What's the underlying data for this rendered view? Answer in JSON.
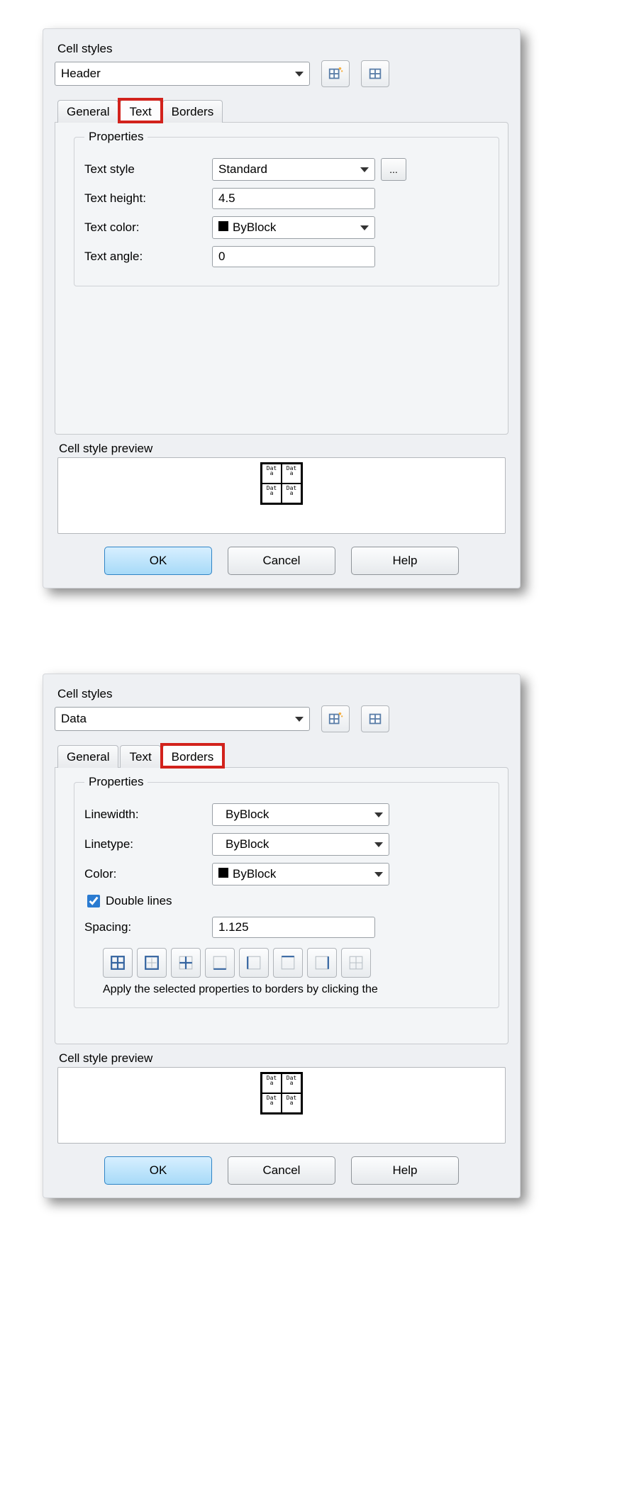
{
  "dialog1": {
    "section_label": "Cell styles",
    "style_dropdown_value": "Header",
    "tabs": {
      "general": "General",
      "text": "Text",
      "borders": "Borders"
    },
    "properties": {
      "legend": "Properties",
      "text_style_label": "Text style",
      "text_style_value": "Standard",
      "text_height_label": "Text height:",
      "text_height_value": "4.5",
      "text_color_label": "Text color:",
      "text_color_value": "ByBlock",
      "text_angle_label": "Text angle:",
      "text_angle_value": "0",
      "browse_label": "..."
    },
    "preview_label": "Cell style preview",
    "buttons": {
      "ok": "OK",
      "cancel": "Cancel",
      "help": "Help"
    }
  },
  "dialog2": {
    "section_label": "Cell styles",
    "style_dropdown_value": "Data",
    "tabs": {
      "general": "General",
      "text": "Text",
      "borders": "Borders"
    },
    "properties": {
      "legend": "Properties",
      "linewidth_label": "Linewidth:",
      "linewidth_value": "ByBlock",
      "linetype_label": "Linetype:",
      "linetype_value": "ByBlock",
      "color_label": "Color:",
      "color_value": "ByBlock",
      "double_lines_label": "Double lines",
      "spacing_label": "Spacing:",
      "spacing_value": "1.125",
      "hint": "Apply the selected properties to borders by clicking the"
    },
    "preview_label": "Cell style preview",
    "buttons": {
      "ok": "OK",
      "cancel": "Cancel",
      "help": "Help"
    }
  }
}
